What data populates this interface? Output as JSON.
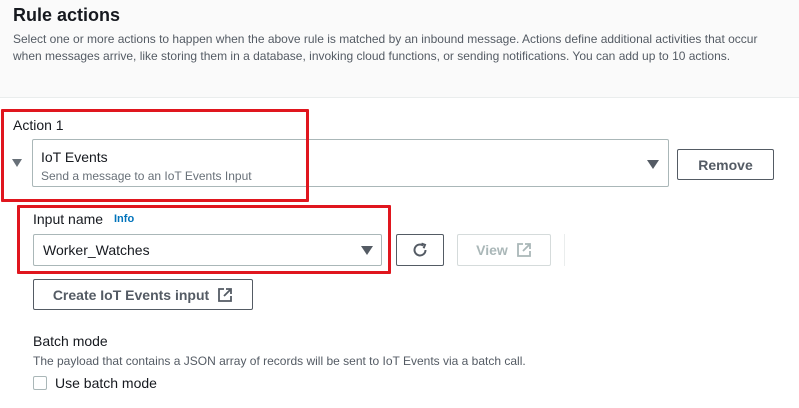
{
  "section": {
    "title": "Rule actions",
    "description": "Select one or more actions to happen when the above rule is matched by an inbound message. Actions define additional activities that occur when messages arrive, like storing them in a database, invoking cloud functions, or sending notifications. You can add up to 10 actions."
  },
  "action": {
    "label": "Action 1",
    "selected_title": "IoT Events",
    "selected_description": "Send a message to an IoT Events Input",
    "remove_label": "Remove"
  },
  "input_name": {
    "label": "Input name",
    "info": "Info",
    "value": "Worker_Watches",
    "view_label": "View",
    "create_label": "Create IoT Events input"
  },
  "batch": {
    "label": "Batch mode",
    "description": "The payload that contains a JSON array of records will be sent to IoT Events via a batch call.",
    "checkbox_label": "Use batch mode"
  },
  "colors": {
    "highlight": "#e0161e",
    "link": "#0073bb"
  }
}
